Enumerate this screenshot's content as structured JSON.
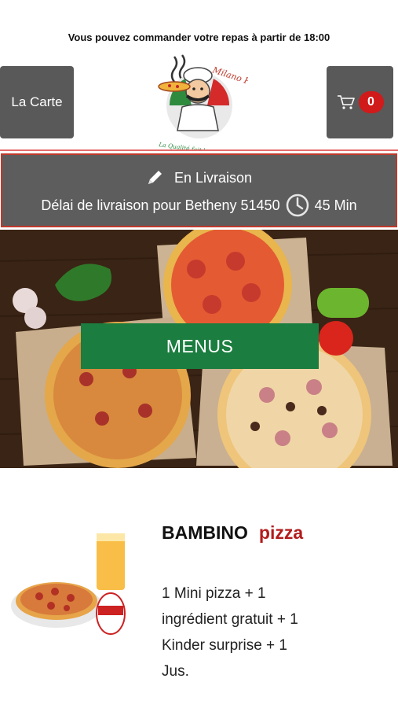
{
  "notice": "Vous pouvez commander votre repas à partir de 18:00",
  "header": {
    "menu_label": "La Carte",
    "cart_count": "0",
    "logo_text_top": "Milano Pizza",
    "logo_text_bottom": "La Qualité fait la différence"
  },
  "delivery": {
    "mode": "En Livraison",
    "info": "Délai de livraison pour Betheny 51450",
    "time": "45 Min"
  },
  "hero": {
    "button_label": "MENUS"
  },
  "product": {
    "name": "BAMBINO",
    "category": "pizza",
    "description": "1 Mini pizza + 1 ingrédient gratuit + 1 Kinder surprise + 1 Jus."
  },
  "colors": {
    "accent_green": "#1b7d3f",
    "accent_red": "#b31c1c",
    "panel_gray": "#5d5d5d"
  },
  "icons": [
    "pencil-icon",
    "clock-icon",
    "cart-icon"
  ]
}
